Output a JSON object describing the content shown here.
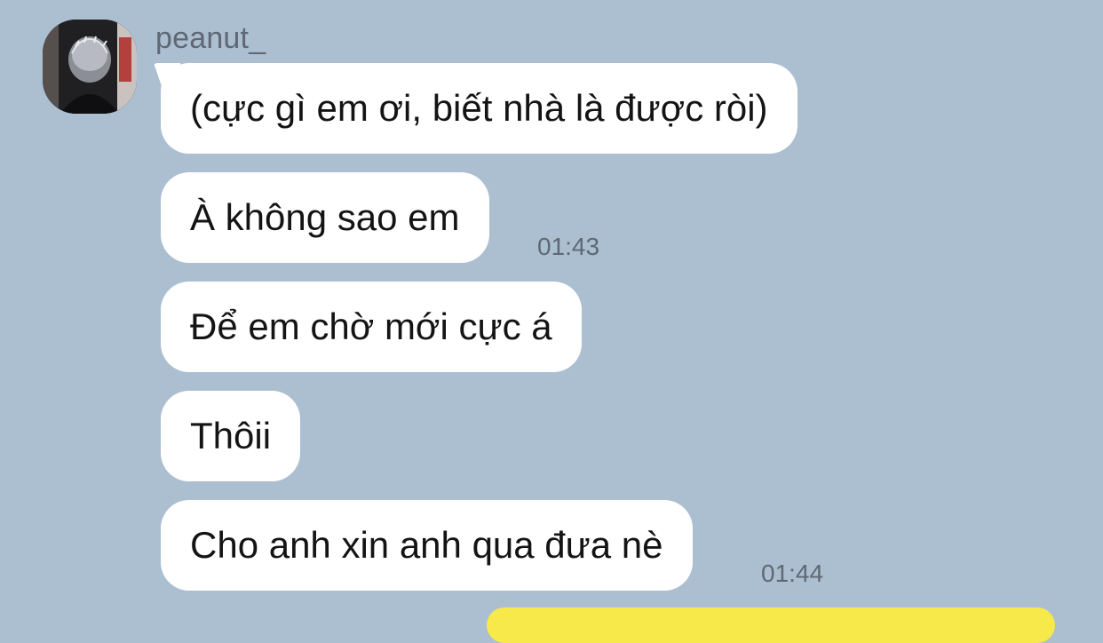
{
  "conversation": {
    "sender": {
      "name": "peanut_",
      "avatar": "avatar-photo"
    },
    "messages": [
      {
        "text": "(cực gì em ơi, biết nhà là được ròi)",
        "time": ""
      },
      {
        "text": "À không sao em",
        "time": "01:43"
      },
      {
        "text": "Để em chờ mới cực á",
        "time": ""
      },
      {
        "text": "Thôii",
        "time": ""
      },
      {
        "text": "Cho anh xin anh qua đưa nè",
        "time": "01:44"
      }
    ]
  },
  "colors": {
    "background": "#abbfd1",
    "incoming_bubble": "#ffffff",
    "outgoing_bubble": "#f7e94a",
    "meta_text": "#5f6874"
  }
}
